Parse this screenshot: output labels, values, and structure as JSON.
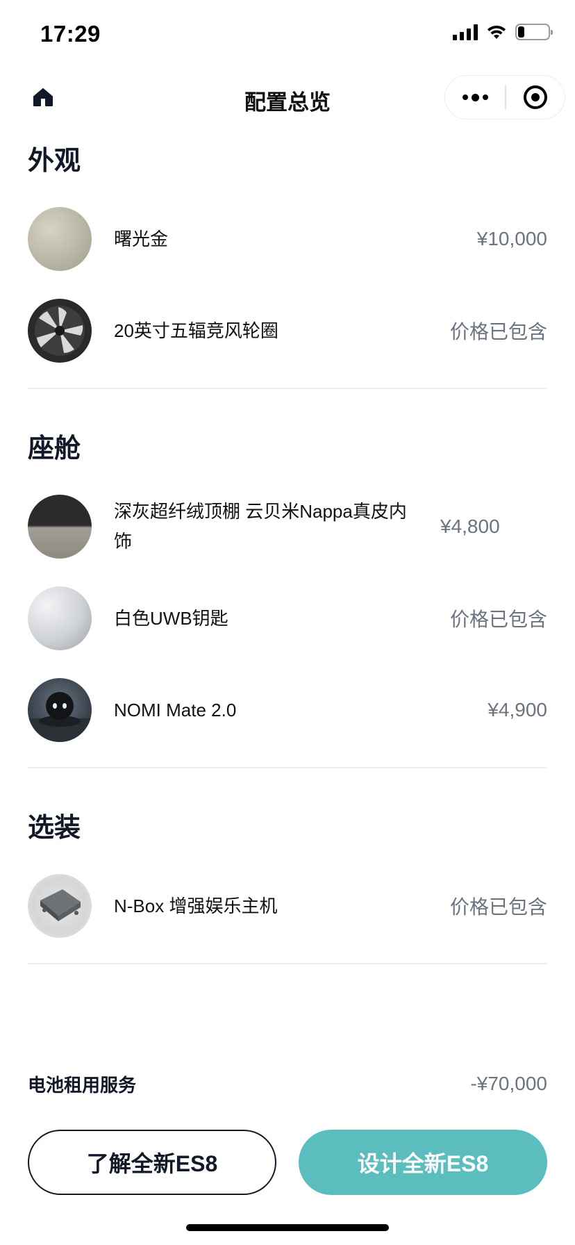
{
  "status_bar": {
    "time": "17:29",
    "icons": [
      "signal-icon",
      "wifi-icon",
      "battery-icon"
    ]
  },
  "nav": {
    "title": "配置总览",
    "home_icon": "home-icon",
    "more_icon": "more-icon",
    "close_icon": "target-icon"
  },
  "sections": [
    {
      "title": "外观",
      "items": [
        {
          "name": "曙光金",
          "price": "¥10,000",
          "thumb": "gold-paint-swatch"
        },
        {
          "name": "20英寸五辐竞风轮圈",
          "price": "价格已包含",
          "thumb": "wheel-image"
        }
      ]
    },
    {
      "title": "座舱",
      "items": [
        {
          "name": "深灰超纤绒顶棚 云贝米Nappa真皮内饰",
          "price": "¥4,800",
          "thumb": "interior-swatch"
        },
        {
          "name": "白色UWB钥匙",
          "price": "价格已包含",
          "thumb": "key-swatch"
        },
        {
          "name": "NOMI Mate 2.0",
          "price": "¥4,900",
          "thumb": "nomi-image"
        }
      ]
    },
    {
      "title": "选装",
      "items": [
        {
          "name": "N-Box 增强娱乐主机",
          "price": "价格已包含",
          "thumb": "nbox-image"
        }
      ]
    }
  ],
  "battery_service": {
    "label": "电池租用服务",
    "price": "-¥70,000"
  },
  "buttons": {
    "learn": "了解全新ES8",
    "design": "设计全新ES8"
  },
  "colors": {
    "accent": "#5bbdbe",
    "primary_text": "#111827",
    "secondary_text": "#6b7280"
  }
}
